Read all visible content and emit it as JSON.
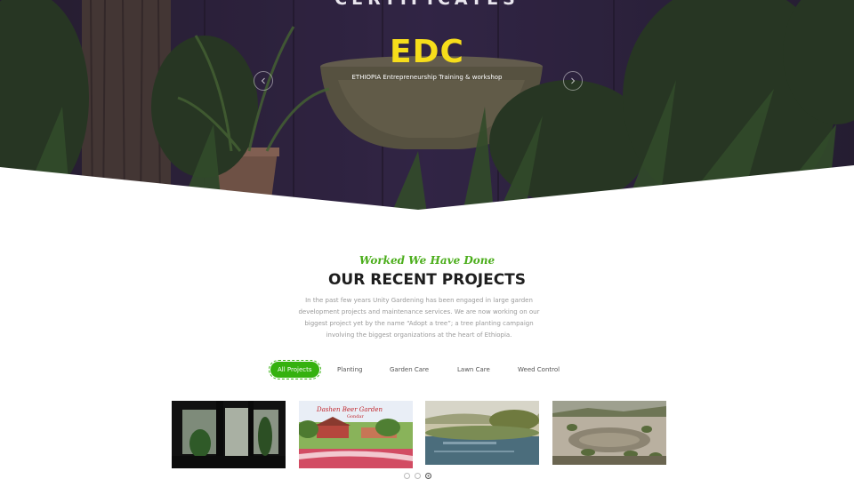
{
  "hero": {
    "heading": "CERTIFICATES",
    "title": "EDC",
    "subtitle": "ETHIOPIA Entrepreneurship Training & workshop",
    "prev_icon": "chevron-left-icon",
    "next_icon": "chevron-right-icon"
  },
  "projects": {
    "kicker": "Worked We Have Done",
    "title": "OUR RECENT PROJECTS",
    "description": "In the past few years Unity Gardening has been engaged in large garden development projects and maintenance services. We are now working on our biggest project yet by the name “Adopt a tree”; a tree planting campaign involving the biggest organizations at the heart of Ethiopia.",
    "filters": [
      "All Projects",
      "Planting",
      "Garden Care",
      "Lawn Care",
      "Weed Control"
    ],
    "active_filter": "All Projects",
    "thumb2_caption_line1": "Dashen Beer Garden",
    "thumb2_caption_line2": "Gondar",
    "pagination_active": 3
  },
  "colors": {
    "accent_green": "#35b10f",
    "title_yellow": "#f6dd1b",
    "kicker_green": "#4cae1c"
  }
}
